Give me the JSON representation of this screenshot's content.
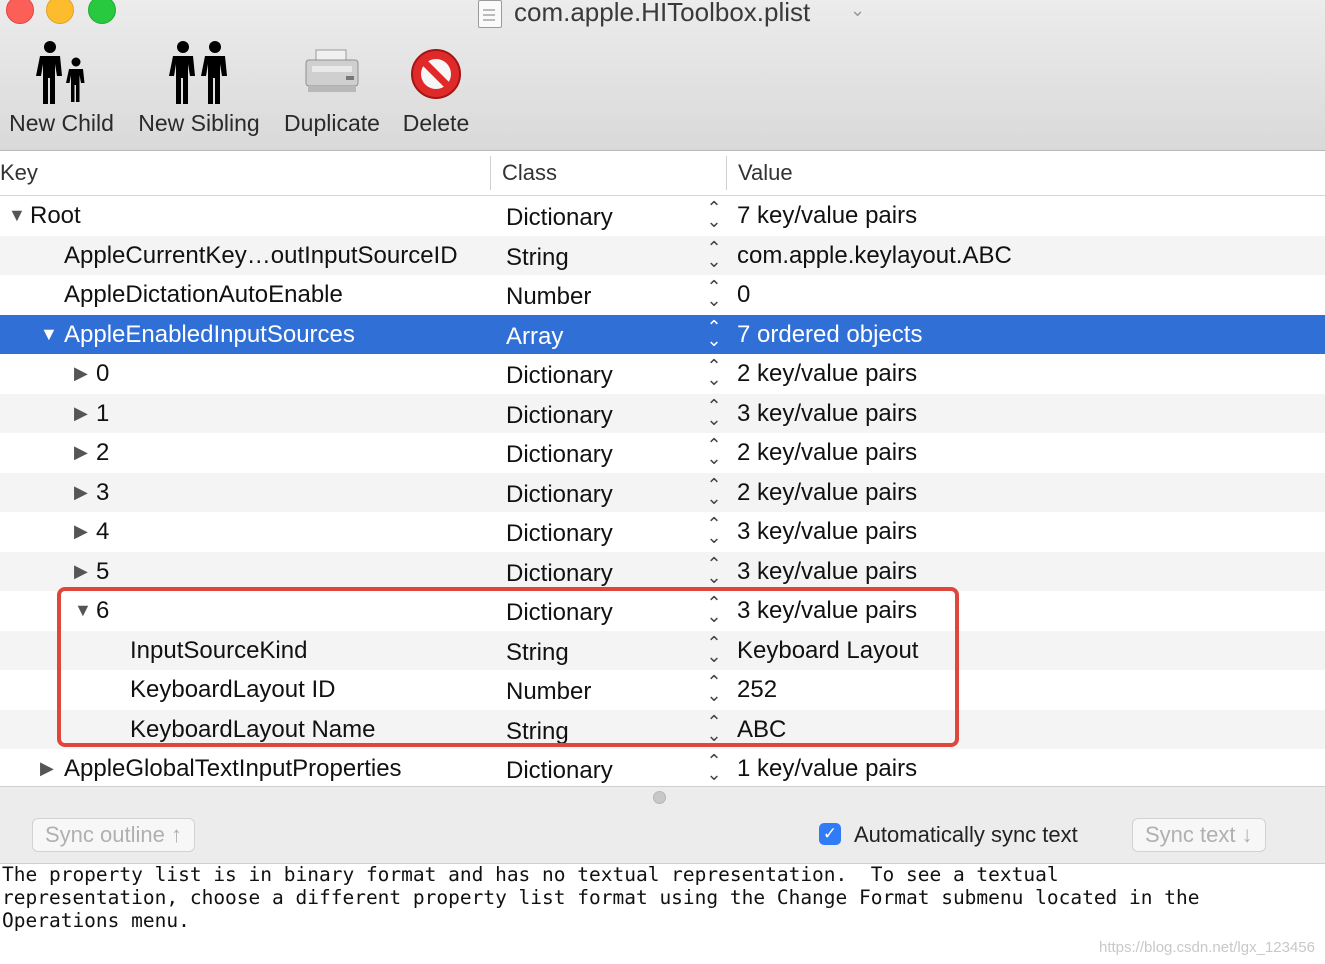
{
  "window": {
    "title": "com.apple.HIToolbox.plist"
  },
  "toolbar": {
    "new_child": "New Child",
    "new_sibling": "New Sibling",
    "duplicate": "Duplicate",
    "delete": "Delete"
  },
  "table": {
    "headers": {
      "key": "Key",
      "class": "Class",
      "value": "Value"
    },
    "rows": [
      {
        "key": "Root",
        "class": "Dictionary",
        "value": "7 key/value pairs"
      },
      {
        "key": "AppleCurrentKey…outInputSourceID",
        "class": "String",
        "value": "com.apple.keylayout.ABC"
      },
      {
        "key": "AppleDictationAutoEnable",
        "class": "Number",
        "value": "0"
      },
      {
        "key": "AppleEnabledInputSources",
        "class": "Array",
        "value": "7 ordered objects"
      },
      {
        "key": "0",
        "class": "Dictionary",
        "value": "2 key/value pairs"
      },
      {
        "key": "1",
        "class": "Dictionary",
        "value": "3 key/value pairs"
      },
      {
        "key": "2",
        "class": "Dictionary",
        "value": "2 key/value pairs"
      },
      {
        "key": "3",
        "class": "Dictionary",
        "value": "2 key/value pairs"
      },
      {
        "key": "4",
        "class": "Dictionary",
        "value": "3 key/value pairs"
      },
      {
        "key": "5",
        "class": "Dictionary",
        "value": "3 key/value pairs"
      },
      {
        "key": "6",
        "class": "Dictionary",
        "value": "3 key/value pairs"
      },
      {
        "key": "InputSourceKind",
        "class": "String",
        "value": "Keyboard Layout"
      },
      {
        "key": "KeyboardLayout ID",
        "class": "Number",
        "value": "252"
      },
      {
        "key": "KeyboardLayout Name",
        "class": "String",
        "value": "ABC"
      },
      {
        "key": "AppleGlobalTextInputProperties",
        "class": "Dictionary",
        "value": "1 key/value pairs"
      }
    ]
  },
  "bottom": {
    "sync_outline": "Sync outline ↑",
    "auto_sync_label": "Automatically sync text",
    "auto_sync_checked": true,
    "sync_text": "Sync text ↓",
    "message": "The property list is in binary format and has no textual representation.  To see a textual\nrepresentation, choose a different property list format using the Change Format submenu located in the\nOperations menu."
  },
  "watermark": "https://blog.csdn.net/lgx_123456",
  "colors": {
    "selection": "#2f6fd6",
    "highlight_box": "#e0463b",
    "checkbox": "#2f7cf6"
  },
  "icons": {
    "new_child": "people-parent-child-icon",
    "new_sibling": "people-siblings-icon",
    "duplicate": "copier-icon",
    "delete": "no-entry-icon"
  }
}
